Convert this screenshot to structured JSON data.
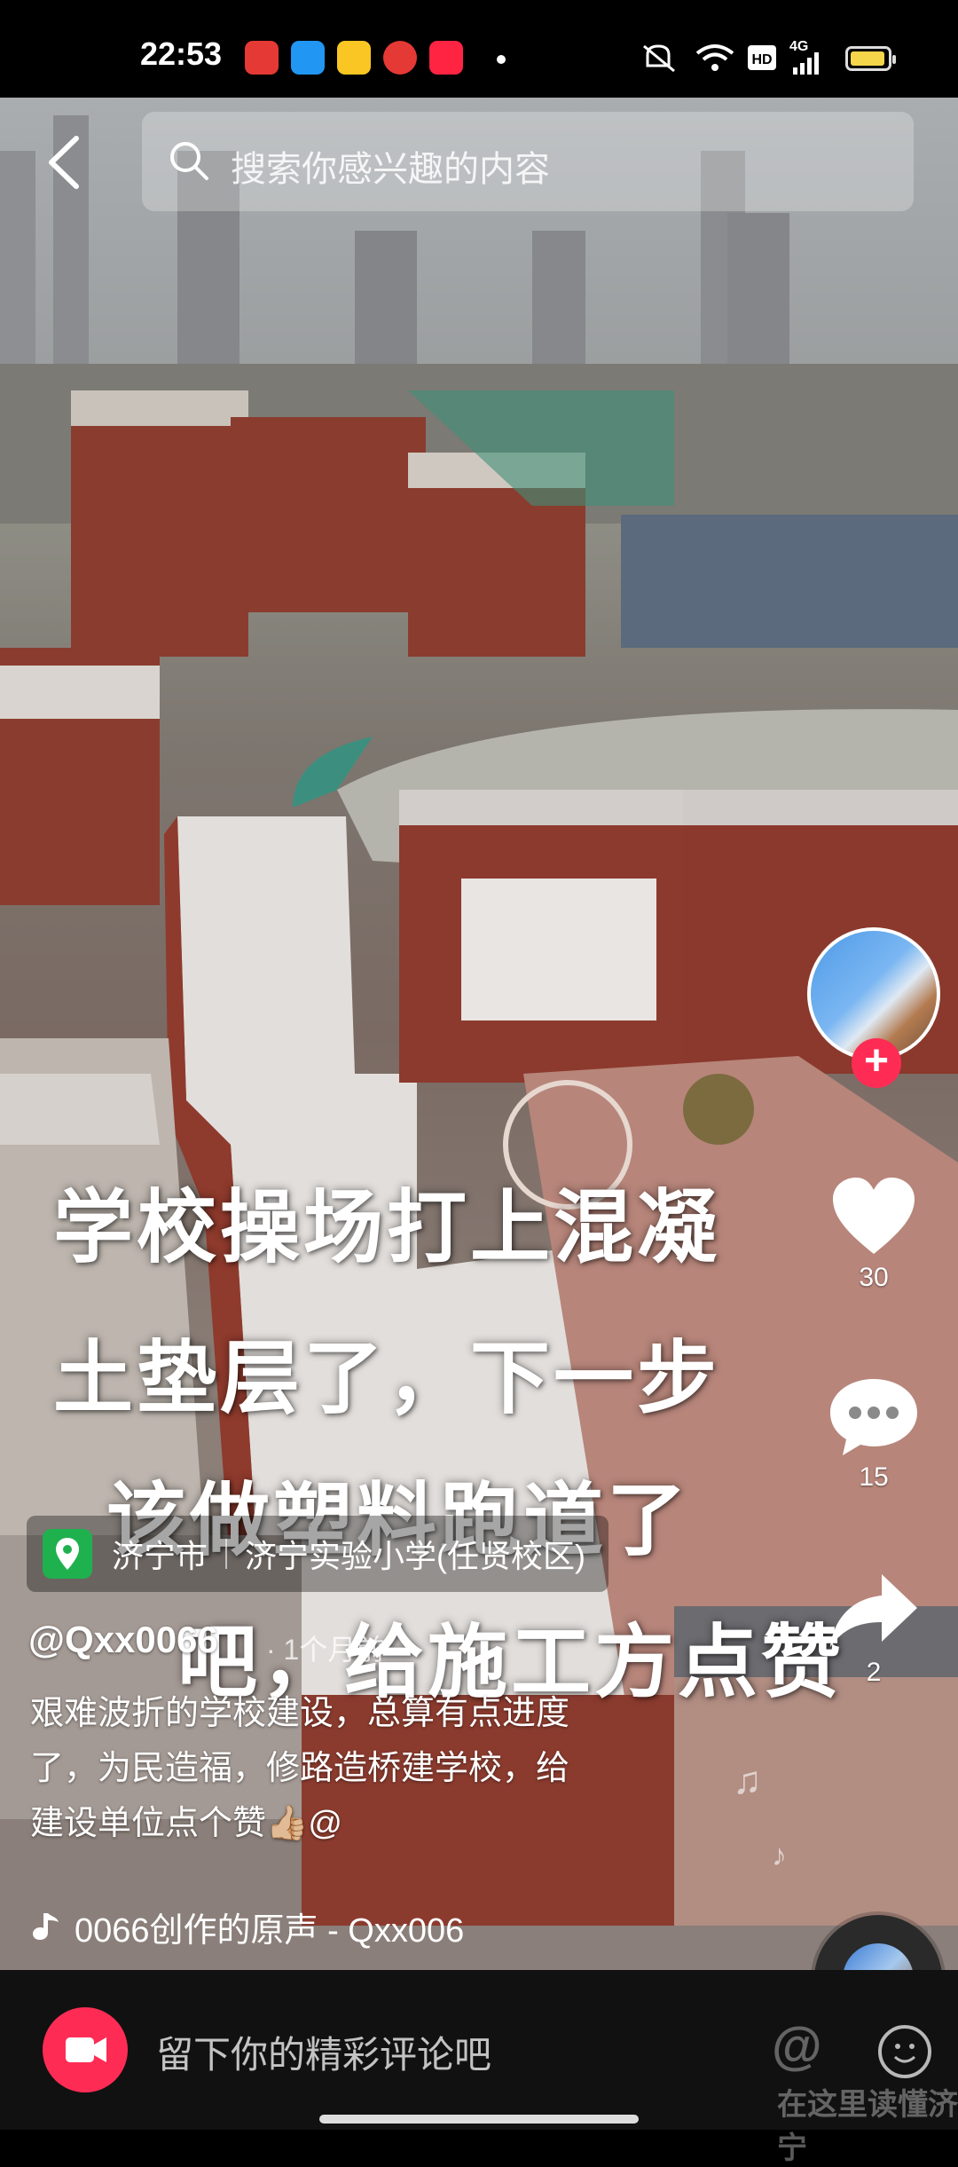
{
  "status_bar": {
    "time": "22:53",
    "notification_icons": [
      "toutiao-icon",
      "browser-icon",
      "notes-icon",
      "video-icon",
      "xiaohongshu-icon"
    ],
    "network": "4G"
  },
  "search": {
    "placeholder": "搜索你感兴趣的内容"
  },
  "video": {
    "overlay_lines": [
      "学校操场打上混凝",
      "土垫层了，下一步",
      "该做塑料跑道了",
      "吧，给施工方点赞"
    ]
  },
  "actions": {
    "like_count": "30",
    "comment_count": "15",
    "share_count": "2"
  },
  "location": {
    "city": "济宁市",
    "place": "济宁实验小学(任贤校区)"
  },
  "post": {
    "author": "@Qxx0066",
    "time_ago": "· 1个月前",
    "description_lines": [
      "艰难波折的学校建设，总算有点进度",
      "了，为民造福，修路造桥建学校，给",
      "建设单位点个赞👍🏼@"
    ],
    "music": "0066创作的原声 - Qxx006"
  },
  "comment": {
    "placeholder": "留下你的精彩评论吧"
  },
  "watermark": {
    "at": "@",
    "text": "在这里读懂济宁"
  },
  "colors": {
    "accent": "#fe2c55",
    "location_badge": "#1fb14e",
    "battery": "#f5d54a"
  }
}
